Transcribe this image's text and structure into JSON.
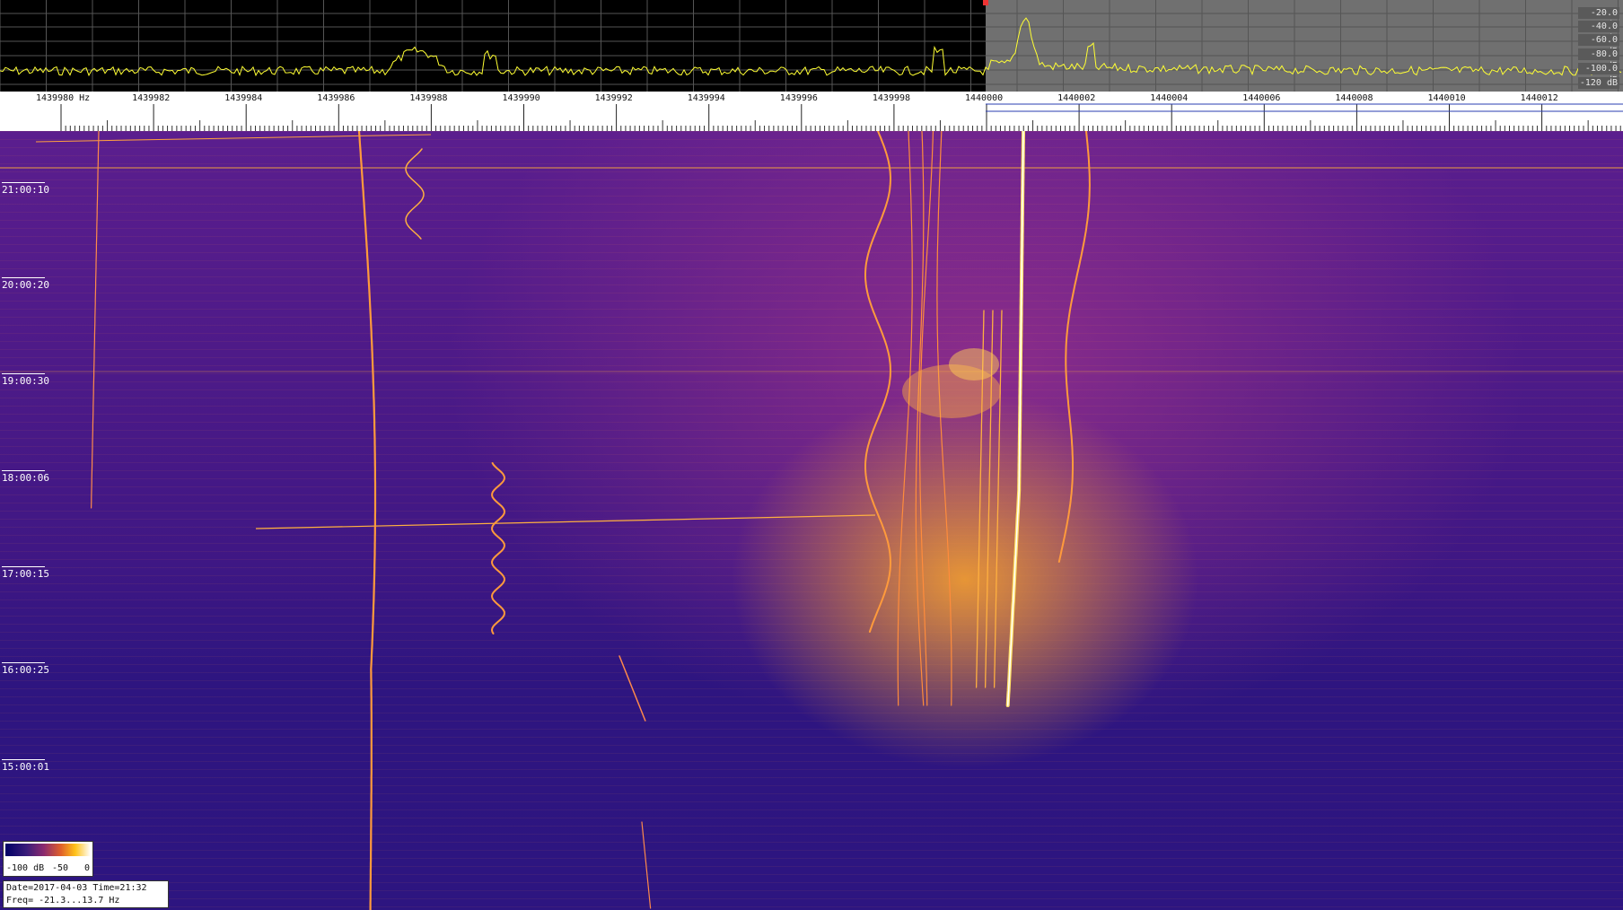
{
  "spectrum": {
    "db_labels": [
      "-20.0 dB",
      "-40.0 dB",
      "-60.0 dB",
      "-80.0 dB",
      "-100.0 dB",
      "-120 dB"
    ]
  },
  "ruler": {
    "freq_labels": [
      "1439980 Hz",
      "1439982",
      "1439984",
      "1439986",
      "1439988",
      "1439990",
      "1439992",
      "1439994",
      "1439996",
      "1439998",
      "1440000",
      "1440002",
      "1440004",
      "1440006",
      "1440008",
      "1440010",
      "1440012"
    ]
  },
  "waterfall": {
    "time_labels": [
      "21:00:10",
      "20:00:20",
      "19:00:30",
      "18:00:06",
      "17:00:15",
      "16:00:25",
      "15:00:01"
    ]
  },
  "colorscale": {
    "min": "-100 dB",
    "mid": "-50",
    "max": "0"
  },
  "info": {
    "line1": "Date=2017-04-03 Time=21:32",
    "line2": "Freq= -21.3...13.7 Hz"
  },
  "colors": {
    "trace": "#ffff33",
    "grid": "#6a6a6a",
    "waterfall_bg": "#3f1784",
    "signal": "#ffcc33"
  },
  "icons": {
    "cursor": "red-square-marker"
  }
}
